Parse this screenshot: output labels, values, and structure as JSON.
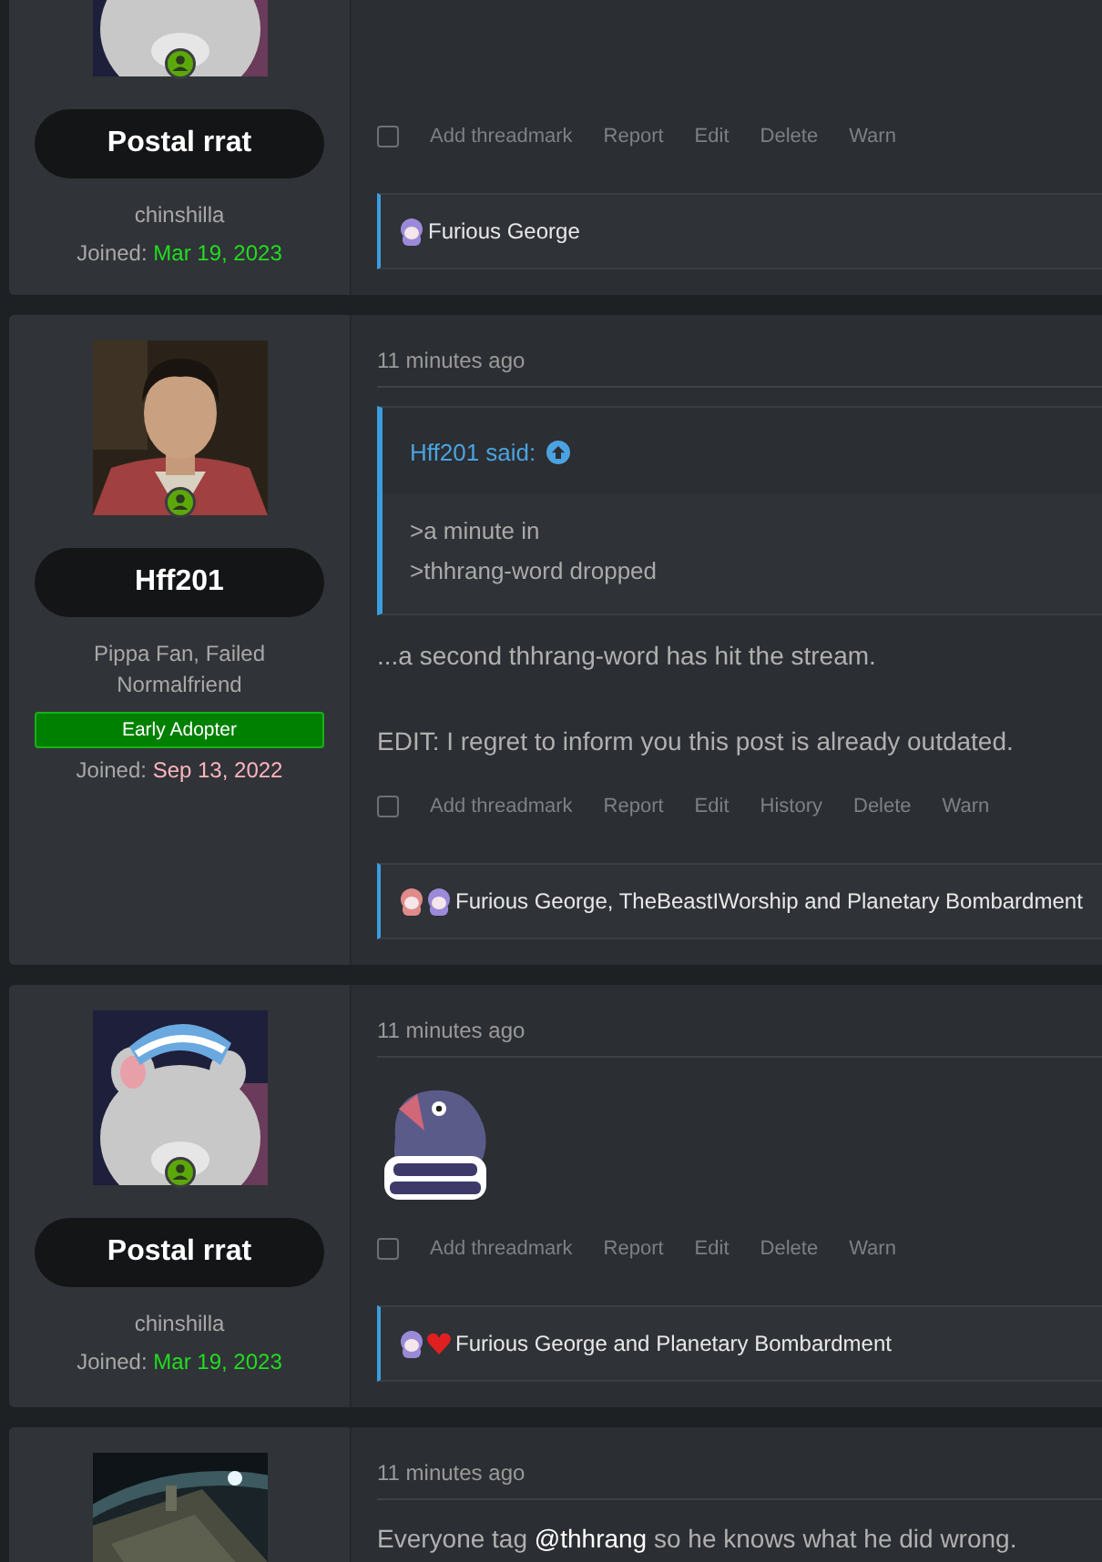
{
  "posts": [
    {
      "author": {
        "name": "Postal rrat",
        "title": "chinshilla",
        "joined_label": "Joined:",
        "joined_date": "Mar 19, 2023",
        "color": "#22dd22"
      },
      "avatar": {
        "kind": "picture",
        "online": true
      },
      "actions": [
        {
          "label": "Add threadmark"
        },
        {
          "label": "Report"
        },
        {
          "label": "Edit"
        },
        {
          "label": "Delete"
        },
        {
          "label": "Warn"
        }
      ],
      "select": {
        "checked": false
      },
      "reactions": {
        "icons": [
          {
            "kind": "face",
            "color": "#9b8ad8"
          }
        ],
        "text": "Furious George"
      }
    },
    {
      "author": {
        "name": "Hff201",
        "title": "Pippa Fan, Failed Normalfriend",
        "banner": "Early Adopter",
        "joined_label": "Joined:",
        "joined_date": "Sep 13, 2022",
        "color": "#ffb6c1"
      },
      "avatar": {
        "kind": "picture",
        "online": true
      },
      "time": "11 minutes ago",
      "quote": {
        "author": "Hff201 said:",
        "lines": [
          ">a minute in",
          ">thhrang-word dropped"
        ]
      },
      "body": [
        {
          "kind": "text",
          "segments": [
            {
              "kind": "plain",
              "text": "...a second thhrang-word has hit the stream."
            }
          ]
        },
        {
          "kind": "text",
          "segments": [
            {
              "kind": "plain",
              "text": "EDIT: I regret to inform you this post is already outdated."
            }
          ]
        }
      ],
      "actions": [
        {
          "label": "Add threadmark"
        },
        {
          "label": "Report"
        },
        {
          "label": "Edit"
        },
        {
          "label": "History"
        },
        {
          "label": "Delete"
        },
        {
          "label": "Warn"
        }
      ],
      "select": {
        "checked": false
      },
      "reactions": {
        "icons": [
          {
            "kind": "face",
            "color": "#e08a8a"
          },
          {
            "kind": "face",
            "color": "#9b8ad8"
          }
        ],
        "text": "Furious George, TheBeastIWorship and Planetary Bombardment"
      }
    },
    {
      "author": {
        "name": "Postal rrat",
        "title": "chinshilla",
        "joined_label": "Joined:",
        "joined_date": "Mar 19, 2023",
        "color": "#22dd22"
      },
      "avatar": {
        "kind": "picture",
        "online": true
      },
      "time": "11 minutes ago",
      "body": [
        {
          "kind": "picture"
        }
      ],
      "actions": [
        {
          "label": "Add threadmark"
        },
        {
          "label": "Report"
        },
        {
          "label": "Edit"
        },
        {
          "label": "Delete"
        },
        {
          "label": "Warn"
        }
      ],
      "select": {
        "checked": false
      },
      "reactions": {
        "icons": [
          {
            "kind": "face",
            "color": "#9b8ad8"
          },
          {
            "kind": "heart",
            "color": "#e02020"
          }
        ],
        "text": "Furious George and Planetary Bombardment"
      }
    },
    {
      "avatar": {
        "kind": "picture"
      },
      "time": "11 minutes ago",
      "body": [
        {
          "kind": "text",
          "segments": [
            {
              "kind": "plain",
              "text": "Everyone tag "
            },
            {
              "kind": "mention",
              "text": "@thhrang"
            },
            {
              "kind": "plain",
              "text": " so he knows what he did wrong."
            }
          ]
        }
      ]
    }
  ]
}
